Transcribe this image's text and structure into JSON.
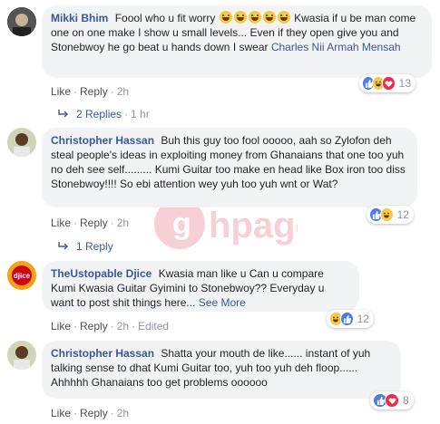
{
  "comments": [
    {
      "author": "Mikki Bhim",
      "text_before_emoji": "Foool who u fit worry",
      "emoji_count": 5,
      "text_after_emoji": "Kwasia if u be man come one on one make I show u small levels... Even if they open give you and Stonebwoy he go beat u hands down I swear",
      "mention": "Charles Nii Armah Mensah",
      "like": "Like",
      "reply": "Reply",
      "time": "2h",
      "reaction_count": "13",
      "reactions": [
        "like-icon",
        "haha-icon",
        "love-icon"
      ]
    },
    {
      "author": "Christopher Hassan",
      "text": "Buh this guy too fool ooooo, aah so Zylofon deh steal people's ideas in exploiting money from Ghanaians that one too yuh no deh see self......... Kumi Guitar too make en head like Box iron too diss Stonebwoy!!!! So ebi attention wey yuh too yuh wnt or Wat?",
      "like": "Like",
      "reply": "Reply",
      "time": "2h",
      "reaction_count": "12",
      "reactions": [
        "like-icon",
        "haha-icon"
      ]
    },
    {
      "author": "TheUstopable Djice",
      "text": "Kwasia man like u Can u compare Kumi Kwasia Guitar Gyimini to Stonebwoy?? Everyday u want to post shit things here...",
      "see_more": "See More",
      "like": "Like",
      "reply": "Reply",
      "time": "2h",
      "edited": "Edited",
      "reaction_count": "12",
      "reactions": [
        "haha-icon",
        "like-icon"
      ]
    },
    {
      "author": "Christopher Hassan",
      "text": "Shatta your mouth de like...... instant of yuh talking sense to dhat Kumi Guitar too, yuh too yuh deh floop...... Ahhhhh Ghanaians too get problems oooooo",
      "like": "Like",
      "reply": "Reply",
      "time": "2h",
      "reaction_count": "8",
      "reactions": [
        "like-icon",
        "love-icon"
      ]
    }
  ],
  "reply_links": [
    {
      "label": "2 Replies",
      "time": "1 hr"
    },
    {
      "label": "1 Reply"
    }
  ],
  "colors": {
    "link": "#385898",
    "bubble": "#f2f3f5",
    "meta": "#90949c",
    "like_blue": "#4b7bec",
    "love_red": "#f0284a",
    "haha_yellow": "#f7c947"
  }
}
